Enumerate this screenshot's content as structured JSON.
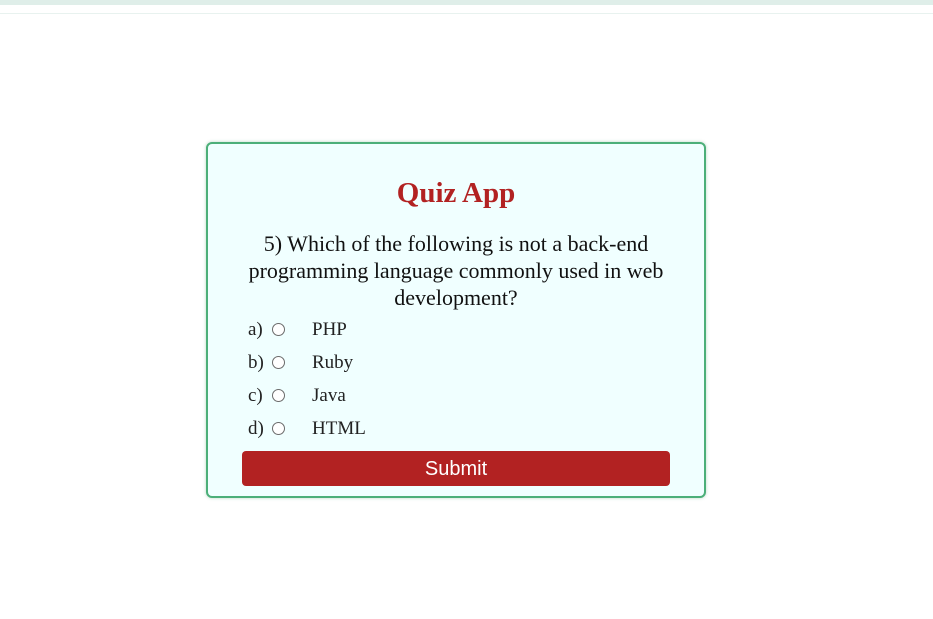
{
  "quiz": {
    "title": "Quiz App",
    "question": "5) Which of the following is not a back-end programming language commonly used in web development?",
    "options": [
      {
        "letter": "a)",
        "text": "PHP"
      },
      {
        "letter": "b)",
        "text": "Ruby"
      },
      {
        "letter": "c)",
        "text": "Java"
      },
      {
        "letter": "d)",
        "text": "HTML"
      }
    ],
    "submit_label": "Submit"
  },
  "colors": {
    "accent": "#b22222",
    "card_background": "#f0ffff",
    "card_border": "#4caf79"
  }
}
